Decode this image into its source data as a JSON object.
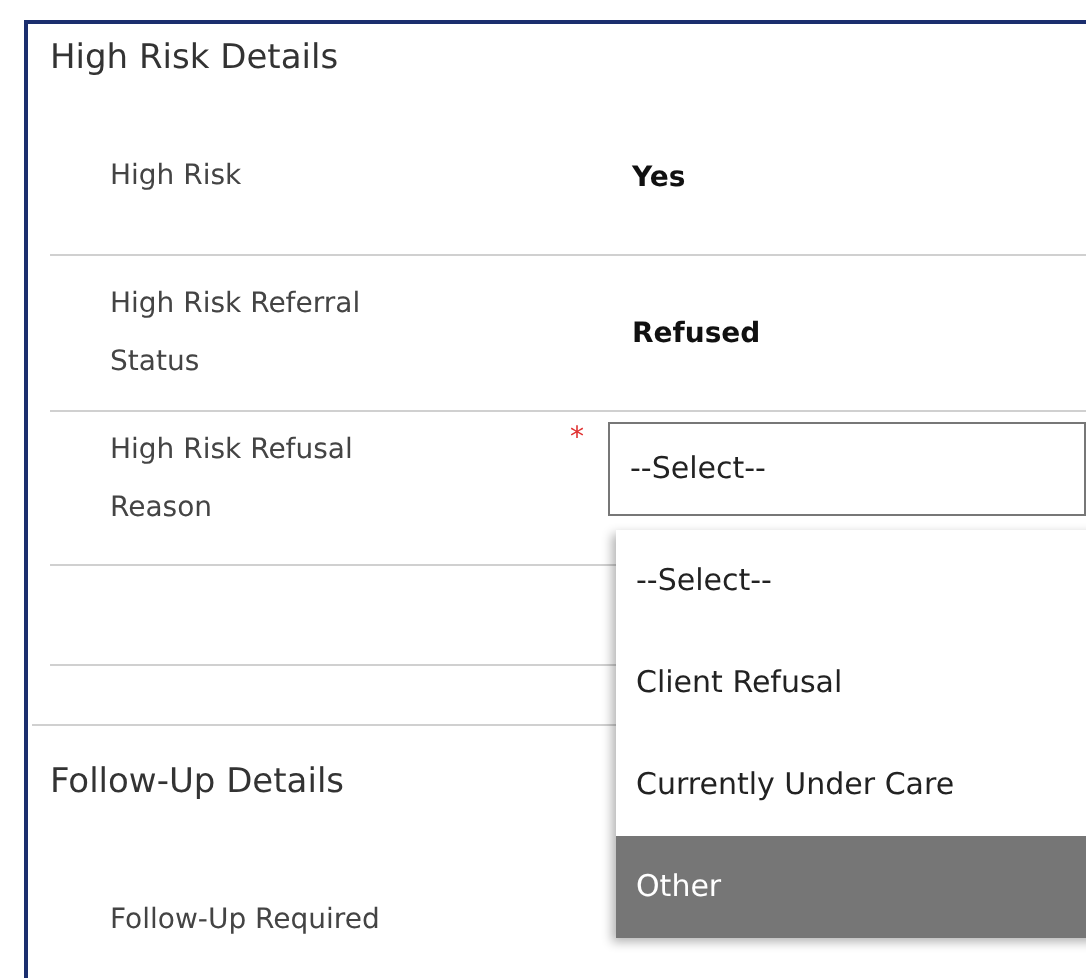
{
  "sections": [
    {
      "title": "High Risk Details",
      "fields": [
        {
          "kind": "text",
          "label": "High Risk",
          "value": "Yes"
        },
        {
          "kind": "text",
          "label": "High Risk Referral Status",
          "value": "Refused"
        },
        {
          "kind": "select",
          "label": "High Risk Refusal Reason",
          "required_mark": "*",
          "value": "--Select--",
          "expanded": true,
          "options": [
            {
              "label": "--Select--",
              "highlighted": false
            },
            {
              "label": "Client Refusal",
              "highlighted": false
            },
            {
              "label": "Currently Under Care",
              "highlighted": false
            },
            {
              "label": "Other",
              "highlighted": true
            }
          ]
        }
      ]
    },
    {
      "title": "Follow-Up Details",
      "fields": [
        {
          "kind": "text",
          "label": "Follow-Up Required"
        }
      ]
    }
  ]
}
